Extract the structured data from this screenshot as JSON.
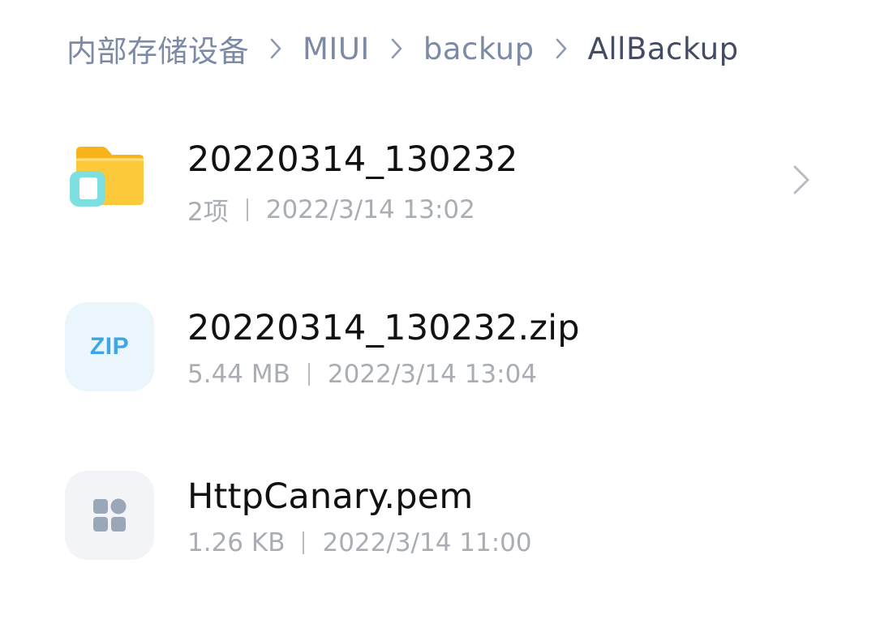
{
  "breadcrumb": {
    "items": [
      {
        "label": "内部存储设备",
        "current": false
      },
      {
        "label": "MIUI",
        "current": false
      },
      {
        "label": "backup",
        "current": false
      },
      {
        "label": "AllBackup",
        "current": true
      }
    ]
  },
  "files": [
    {
      "name": "20220314_130232",
      "type": "folder",
      "icon": "folder-icon",
      "size": "2项",
      "modified": "2022/3/14 13:02",
      "has_chevron": true
    },
    {
      "name": "20220314_130232.zip",
      "type": "zip",
      "icon": "zip-file-icon",
      "icon_label": "ZIP",
      "size": "5.44 MB",
      "modified": "2022/3/14 13:04",
      "has_chevron": false
    },
    {
      "name": "HttpCanary.pem",
      "type": "other",
      "icon": "generic-file-icon",
      "size": "1.26 KB",
      "modified": "2022/3/14 11:00",
      "has_chevron": false
    }
  ],
  "colors": {
    "breadcrumb_text": "#7d8aa6",
    "breadcrumb_current": "#434c63",
    "file_name": "#111111",
    "file_meta": "#a9adb4",
    "folder_yellow": "#fbc02d",
    "folder_badge": "#7ddfe0",
    "zip_text": "#3da6e6",
    "zip_bg": "#eaf5fc",
    "generic_icon": "#9aa7b8"
  }
}
